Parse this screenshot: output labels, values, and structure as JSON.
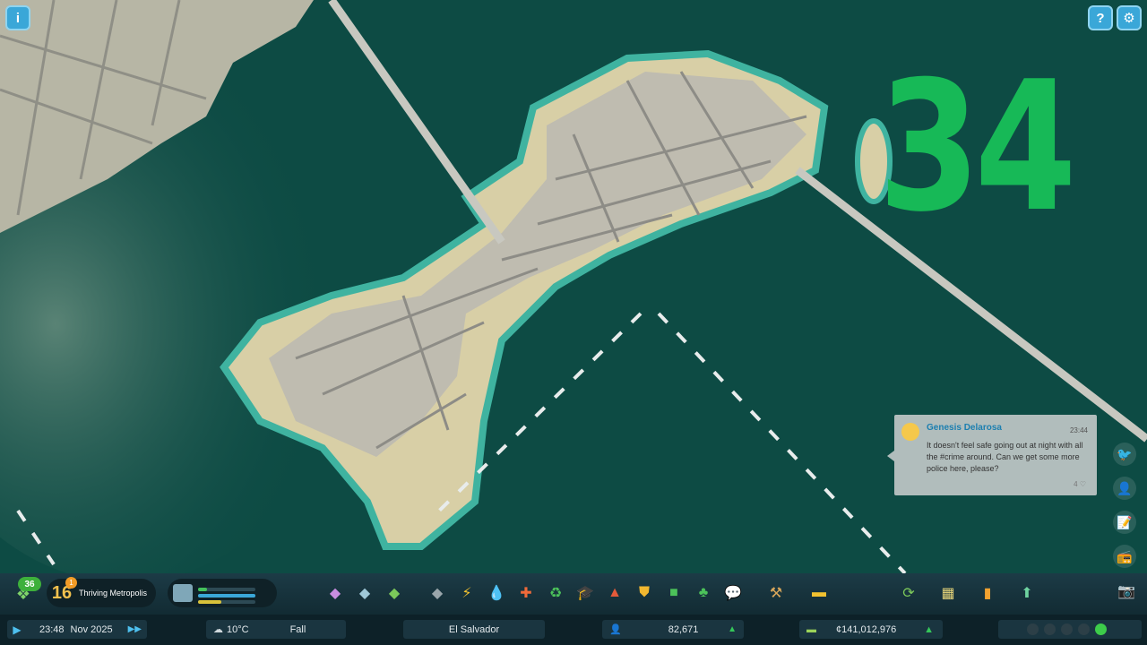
{
  "overlay": {
    "episode_number": "34"
  },
  "corner_buttons": {
    "info_icon": "i",
    "help_icon": "?",
    "settings_icon": "⚙"
  },
  "chirp": {
    "author": "Genesis Delarosa",
    "time": "23:44",
    "text": "It doesn't feel safe going out at night with all the #crime around. Can we get some more police here, please?",
    "likes": "4 ♡"
  },
  "toolbar": {
    "xp_count": "36",
    "milestone_level": "16",
    "milestone_badge": "1",
    "milestone_name": "Thriving Metropolis",
    "tools": [
      "zoning-icon",
      "area-icon",
      "landscaping-icon",
      "roads-icon",
      "electricity-icon",
      "water-icon",
      "healthcare-icon",
      "garbage-icon",
      "education-icon",
      "fire-icon",
      "police-icon",
      "transport-icon",
      "parks-icon",
      "communications-icon",
      "bulldoze-icon",
      "terraform-icon"
    ],
    "right_tools": [
      "policies-icon",
      "map-icon",
      "statistics-icon",
      "progression-icon"
    ]
  },
  "statusbar": {
    "time": "23:48",
    "date": "Nov 2025",
    "temperature": "10°C",
    "season": "Fall",
    "city_name": "El Salvador",
    "population": "82,671",
    "money": "¢141,012,976"
  },
  "colors": {
    "episode_green": "#17b957",
    "water": "#0c4a44",
    "toolbar_bg": "#1c3b46",
    "accent_blue": "#4ec0ef"
  }
}
